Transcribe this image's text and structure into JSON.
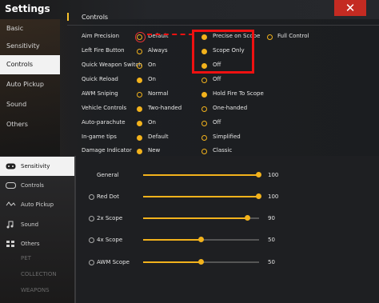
{
  "header": {
    "title": "Settings",
    "close_label": "✕"
  },
  "sidebar": {
    "items": [
      {
        "label": "Basic"
      },
      {
        "label": "Sensitivity"
      },
      {
        "label": "Controls"
      },
      {
        "label": "Auto Pickup"
      },
      {
        "label": "Sound"
      },
      {
        "label": "Others"
      }
    ]
  },
  "section": {
    "title": "Controls"
  },
  "controls": [
    {
      "label": "Aim Precision",
      "options": [
        "Default",
        "Precise on Scope",
        "Full Control"
      ],
      "selected": 1
    },
    {
      "label": "Left Fire Button",
      "options": [
        "Always",
        "Scope Only"
      ],
      "selected": 1
    },
    {
      "label": "Quick Weapon Switch",
      "options": [
        "On",
        "Off"
      ],
      "selected": 1
    },
    {
      "label": "Quick Reload",
      "options": [
        "On",
        "Off"
      ],
      "selected": 0
    },
    {
      "label": "AWM Sniping",
      "options": [
        "Normal",
        "Hold Fire To Scope"
      ],
      "selected": 1
    },
    {
      "label": "Vehicle Controls",
      "options": [
        "Two-handed",
        "One-handed"
      ],
      "selected": 0
    },
    {
      "label": "Auto-parachute",
      "options": [
        "On",
        "Off"
      ],
      "selected": 0
    },
    {
      "label": "In-game tips",
      "options": [
        "Default",
        "Simplified"
      ],
      "selected": 0
    },
    {
      "label": "Damage Indicator",
      "options": [
        "New",
        "Classic"
      ],
      "selected": 0
    }
  ],
  "bottom_sidebar": {
    "items": [
      {
        "label": "Sensitivity"
      },
      {
        "label": "Controls"
      },
      {
        "label": "Auto Pickup"
      },
      {
        "label": "Sound"
      },
      {
        "label": "Others"
      },
      {
        "label": "PET"
      },
      {
        "label": "COLLECTION"
      },
      {
        "label": "WEAPONS"
      }
    ]
  },
  "sensitivity": [
    {
      "label": "General",
      "value": 100
    },
    {
      "label": "Red Dot",
      "value": 100
    },
    {
      "label": "2x Scope",
      "value": 90
    },
    {
      "label": "4x Scope",
      "value": 50
    },
    {
      "label": "AWM Scope",
      "value": 50
    }
  ],
  "colors": {
    "accent": "#f2b21c",
    "highlight": "#e11111",
    "close": "#c42b22"
  }
}
